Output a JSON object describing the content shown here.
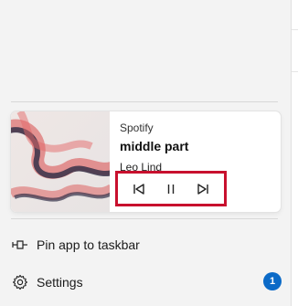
{
  "media_player": {
    "app_name": "Spotify",
    "track_title": "middle part",
    "artist": "Leo Lind",
    "controls": {
      "previous_icon": "skip-previous-icon",
      "pause_icon": "pause-icon",
      "next_icon": "skip-next-icon"
    },
    "highlight_color": "#c8102e"
  },
  "menu_items": {
    "pin": {
      "label": "Pin app to taskbar",
      "icon": "pin-icon"
    },
    "settings": {
      "label": "Settings",
      "icon": "gear-icon",
      "badge": "1"
    }
  },
  "colors": {
    "badge": "#0b6ac7",
    "panel_background": "#f3f3f3"
  }
}
